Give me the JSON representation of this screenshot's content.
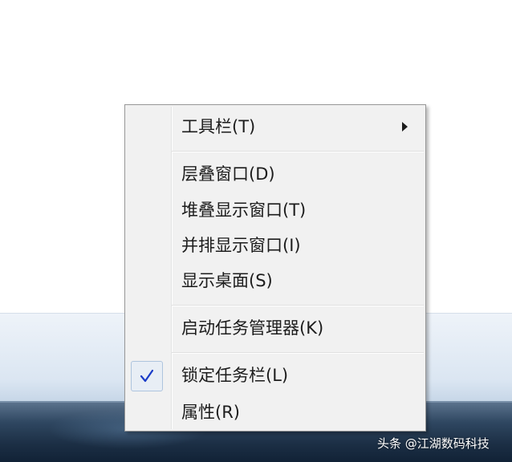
{
  "menu": {
    "items": [
      {
        "label": "工具栏(T)",
        "has_submenu": true
      },
      {
        "label": "层叠窗口(D)"
      },
      {
        "label": "堆叠显示窗口(T)"
      },
      {
        "label": "并排显示窗口(I)"
      },
      {
        "label": "显示桌面(S)"
      },
      {
        "label": "启动任务管理器(K)"
      },
      {
        "label": "锁定任务栏(L)",
        "checked": true
      },
      {
        "label": "属性(R)"
      }
    ]
  },
  "watermark": {
    "text": "头条 @江湖数码科技"
  },
  "colors": {
    "menu_background": "#f1f1f1",
    "menu_border": "#979797",
    "menu_text": "#1c1c1c",
    "check_color": "#1a3cc8",
    "taskbar": "#1c2f45"
  },
  "icons": {
    "check": "checkmark-icon",
    "submenu": "submenu-arrow-icon"
  }
}
